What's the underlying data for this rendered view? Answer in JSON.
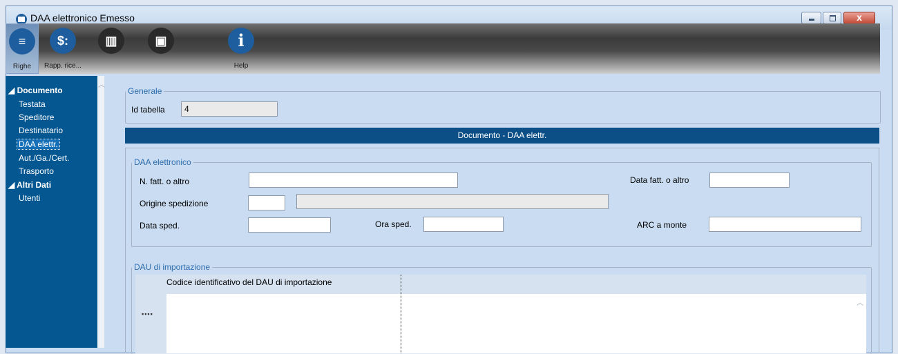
{
  "window": {
    "title": "DAA elettronico Emesso",
    "close_glyph": "x"
  },
  "toolbar": [
    {
      "label": "Righe",
      "icon": "list-icon",
      "glyph": "≡",
      "active": true
    },
    {
      "label": "Rapp. rice...",
      "icon": "dollar-icon",
      "glyph": "$:"
    },
    {
      "label": "",
      "icon": "book-icon",
      "glyph": "▥"
    },
    {
      "label": "",
      "icon": "window-close-icon",
      "glyph": "▣"
    },
    {
      "label": "Help",
      "icon": "info-icon",
      "glyph": "i"
    }
  ],
  "sidebar": {
    "groups": [
      {
        "label": "Documento",
        "children": [
          "Testata",
          "Speditore",
          "Destinatario",
          "DAA elettr.",
          "Aut./Ga./Cert.",
          "Trasporto"
        ]
      },
      {
        "label": "Altri Dati",
        "children": [
          "Utenti"
        ]
      }
    ],
    "selected": "DAA elettr."
  },
  "generale": {
    "legend": "Generale",
    "id_label": "Id tabella",
    "id_value": "4"
  },
  "banner": "Documento - DAA elettr.",
  "daa": {
    "legend": "DAA elettronico",
    "n_fatt_label": "N. fatt. o altro",
    "n_fatt_value": "",
    "data_fatt_label": "Data fatt. o altro",
    "data_fatt_value": "",
    "origine_label": "Origine spedizione",
    "origine_code": "",
    "origine_desc": "",
    "data_sped_label": "Data sped.",
    "data_sped_value": "",
    "ora_sped_label": "Ora sped.",
    "ora_sped_value": "",
    "arc_label": "ARC a monte",
    "arc_value": ""
  },
  "dau": {
    "legend": "DAU di importazione",
    "column": "Codice identificativo del DAU di importazione"
  },
  "colors": {
    "sidebar": "#055792",
    "banner": "#0b4f86",
    "legend": "#2e6dad"
  }
}
